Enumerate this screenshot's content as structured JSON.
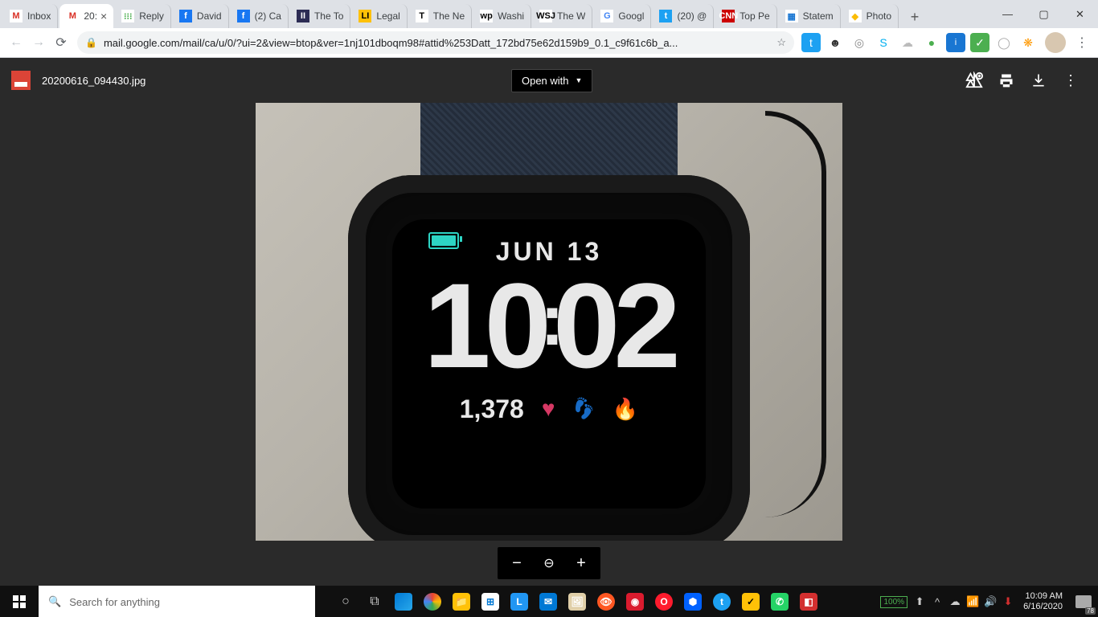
{
  "tabs": [
    {
      "label": "Inbox",
      "fav": "M",
      "favbg": "#fff",
      "favcol": "#d93025"
    },
    {
      "label": "20:",
      "fav": "M",
      "favbg": "#fff",
      "favcol": "#d93025",
      "active": true
    },
    {
      "label": "Reply",
      "fav": "⁝⁝⁝",
      "favbg": "#fff",
      "favcol": "#4caf50"
    },
    {
      "label": "David",
      "fav": "f",
      "favbg": "#1877f2",
      "favcol": "#fff"
    },
    {
      "label": "(2) Ca",
      "fav": "f",
      "favbg": "#1877f2",
      "favcol": "#fff"
    },
    {
      "label": "The To",
      "fav": "II",
      "favbg": "#2c2c54",
      "favcol": "#fff"
    },
    {
      "label": "Legal",
      "fav": "LI",
      "favbg": "#ffc107",
      "favcol": "#000"
    },
    {
      "label": "The Ne",
      "fav": "T",
      "favbg": "#fff",
      "favcol": "#000"
    },
    {
      "label": "Washi",
      "fav": "wp",
      "favbg": "#fff",
      "favcol": "#000"
    },
    {
      "label": "The W",
      "fav": "WSJ",
      "favbg": "#fff",
      "favcol": "#000"
    },
    {
      "label": "Googl",
      "fav": "G",
      "favbg": "#fff",
      "favcol": "#4285f4"
    },
    {
      "label": "(20) @",
      "fav": "t",
      "favbg": "#1da1f2",
      "favcol": "#fff"
    },
    {
      "label": "Top Pe",
      "fav": "CNN",
      "favbg": "#cc0000",
      "favcol": "#fff"
    },
    {
      "label": "Statem",
      "fav": "▦",
      "favbg": "#fff",
      "favcol": "#1976d2"
    },
    {
      "label": "Photo",
      "fav": "◆",
      "favbg": "#fff",
      "favcol": "#fbbc04"
    }
  ],
  "url": "mail.google.com/mail/ca/u/0/?ui=2&view=btop&ver=1nj101dboqm98#attid%253Datt_172bd75e62d159b9_0.1_c9f61c6b_a...",
  "viewer": {
    "filename": "20200616_094430.jpg",
    "openwith": "Open with"
  },
  "watch": {
    "date": "JUN 13",
    "time_h": "10",
    "time_m": "02",
    "steps": "1,378"
  },
  "taskbar": {
    "search_placeholder": "Search for anything",
    "battery": "100%",
    "time": "10:09 AM",
    "date": "6/16/2020",
    "notif": "78"
  }
}
